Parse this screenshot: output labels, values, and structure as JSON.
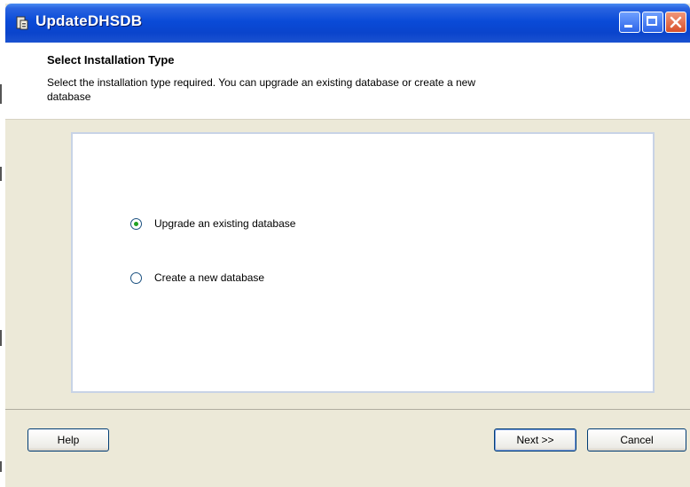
{
  "window": {
    "title": "UpdateDHSDB",
    "controls": [
      "minimize",
      "maximize",
      "close"
    ]
  },
  "header": {
    "title": "Select Installation Type",
    "description": "Select the installation type required. You can upgrade an existing database or create a new database"
  },
  "options": [
    {
      "label": "Upgrade an existing database",
      "selected": true
    },
    {
      "label": "Create a new database",
      "selected": false
    }
  ],
  "buttons": {
    "help": "Help",
    "next": "Next >>",
    "cancel": "Cancel"
  },
  "colors": {
    "titlebar": "#0a4bd8",
    "radio_checked": "#21a121",
    "window_bg": "#ece9d8"
  }
}
